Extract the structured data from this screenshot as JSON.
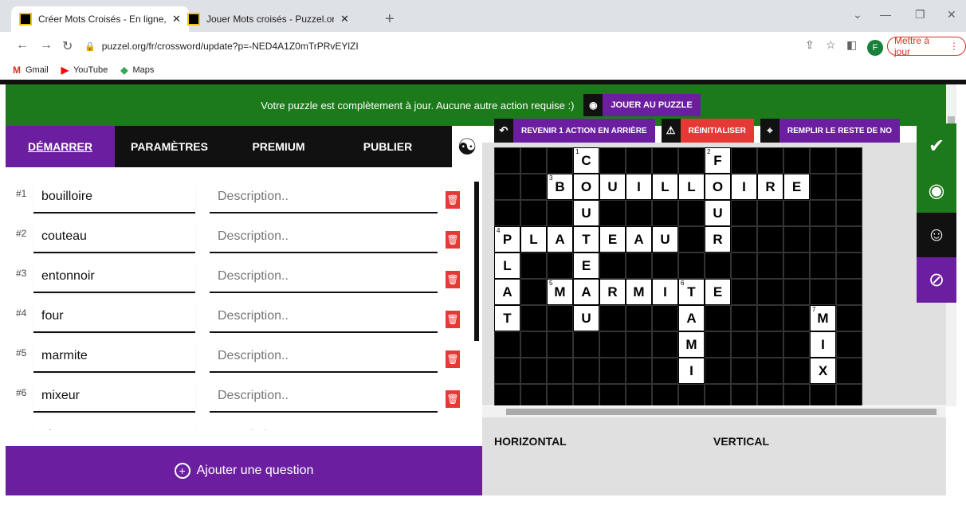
{
  "browser": {
    "tabs": [
      {
        "title": "Créer Mots Croisés - En ligne, gra",
        "active": true
      },
      {
        "title": "Jouer Mots croisés - Puzzel.org",
        "active": false
      }
    ],
    "url": "puzzel.org/fr/crossword/update?p=-NED4A1Z0mTrPRvEYlZI",
    "avatar_letter": "F",
    "update_label": "Mettre à jour",
    "bookmarks": [
      "Gmail",
      "YouTube",
      "Maps"
    ]
  },
  "banner": {
    "message": "Votre puzzle est complètement à jour. Aucune autre action requise :)",
    "play_label": "JOUER AU PUZZLE"
  },
  "tabs": [
    "DÉMARRER",
    "PARAMÈTRES",
    "PREMIUM",
    "PUBLIER"
  ],
  "words": [
    {
      "num": "#1",
      "word": "bouilloire",
      "desc": "Description.."
    },
    {
      "num": "#2",
      "word": "couteau",
      "desc": "Description.."
    },
    {
      "num": "#3",
      "word": "entonnoir",
      "desc": "Description.."
    },
    {
      "num": "#4",
      "word": "four",
      "desc": "Description.."
    },
    {
      "num": "#5",
      "word": "marmite",
      "desc": "Description.."
    },
    {
      "num": "#6",
      "word": "mixeur",
      "desc": "Description.."
    },
    {
      "num": "",
      "word": "plat",
      "desc": "Description.."
    }
  ],
  "add_question": "Ajouter une question",
  "toolbar": {
    "undo": "REVENIR 1 ACTION EN ARRIÈRE",
    "reset": "RÉINITIALISER",
    "fill": "REMPLIR LE RESTE DE NO"
  },
  "clues": {
    "horizontal": "HORIZONTAL",
    "vertical": "VERTICAL"
  },
  "grid": {
    "cols": 14,
    "rows": 10,
    "letters": [
      [
        3,
        0,
        "C",
        1
      ],
      [
        8,
        0,
        "F",
        2
      ],
      [
        2,
        1,
        "B",
        3
      ],
      [
        3,
        1,
        "O"
      ],
      [
        4,
        1,
        "U"
      ],
      [
        5,
        1,
        "I"
      ],
      [
        6,
        1,
        "L"
      ],
      [
        7,
        1,
        "L"
      ],
      [
        8,
        1,
        "O"
      ],
      [
        9,
        1,
        "I"
      ],
      [
        10,
        1,
        "R"
      ],
      [
        11,
        1,
        "E"
      ],
      [
        3,
        2,
        "U"
      ],
      [
        8,
        2,
        "U"
      ],
      [
        0,
        3,
        "P",
        4
      ],
      [
        1,
        3,
        "L"
      ],
      [
        2,
        3,
        "A"
      ],
      [
        3,
        3,
        "T"
      ],
      [
        4,
        3,
        "E"
      ],
      [
        5,
        3,
        "A"
      ],
      [
        6,
        3,
        "U"
      ],
      [
        8,
        3,
        "R"
      ],
      [
        0,
        4,
        "L"
      ],
      [
        3,
        4,
        "E"
      ],
      [
        0,
        5,
        "A"
      ],
      [
        2,
        5,
        "M",
        5
      ],
      [
        3,
        5,
        "A"
      ],
      [
        4,
        5,
        "R"
      ],
      [
        5,
        5,
        "M"
      ],
      [
        6,
        5,
        "I"
      ],
      [
        7,
        5,
        "T",
        6
      ],
      [
        8,
        5,
        "E"
      ],
      [
        0,
        6,
        "T"
      ],
      [
        3,
        6,
        "U"
      ],
      [
        7,
        6,
        "A"
      ],
      [
        12,
        6,
        "M",
        7
      ],
      [
        7,
        7,
        "M"
      ],
      [
        12,
        7,
        "I"
      ],
      [
        7,
        8,
        "I"
      ],
      [
        12,
        8,
        "X"
      ]
    ]
  }
}
